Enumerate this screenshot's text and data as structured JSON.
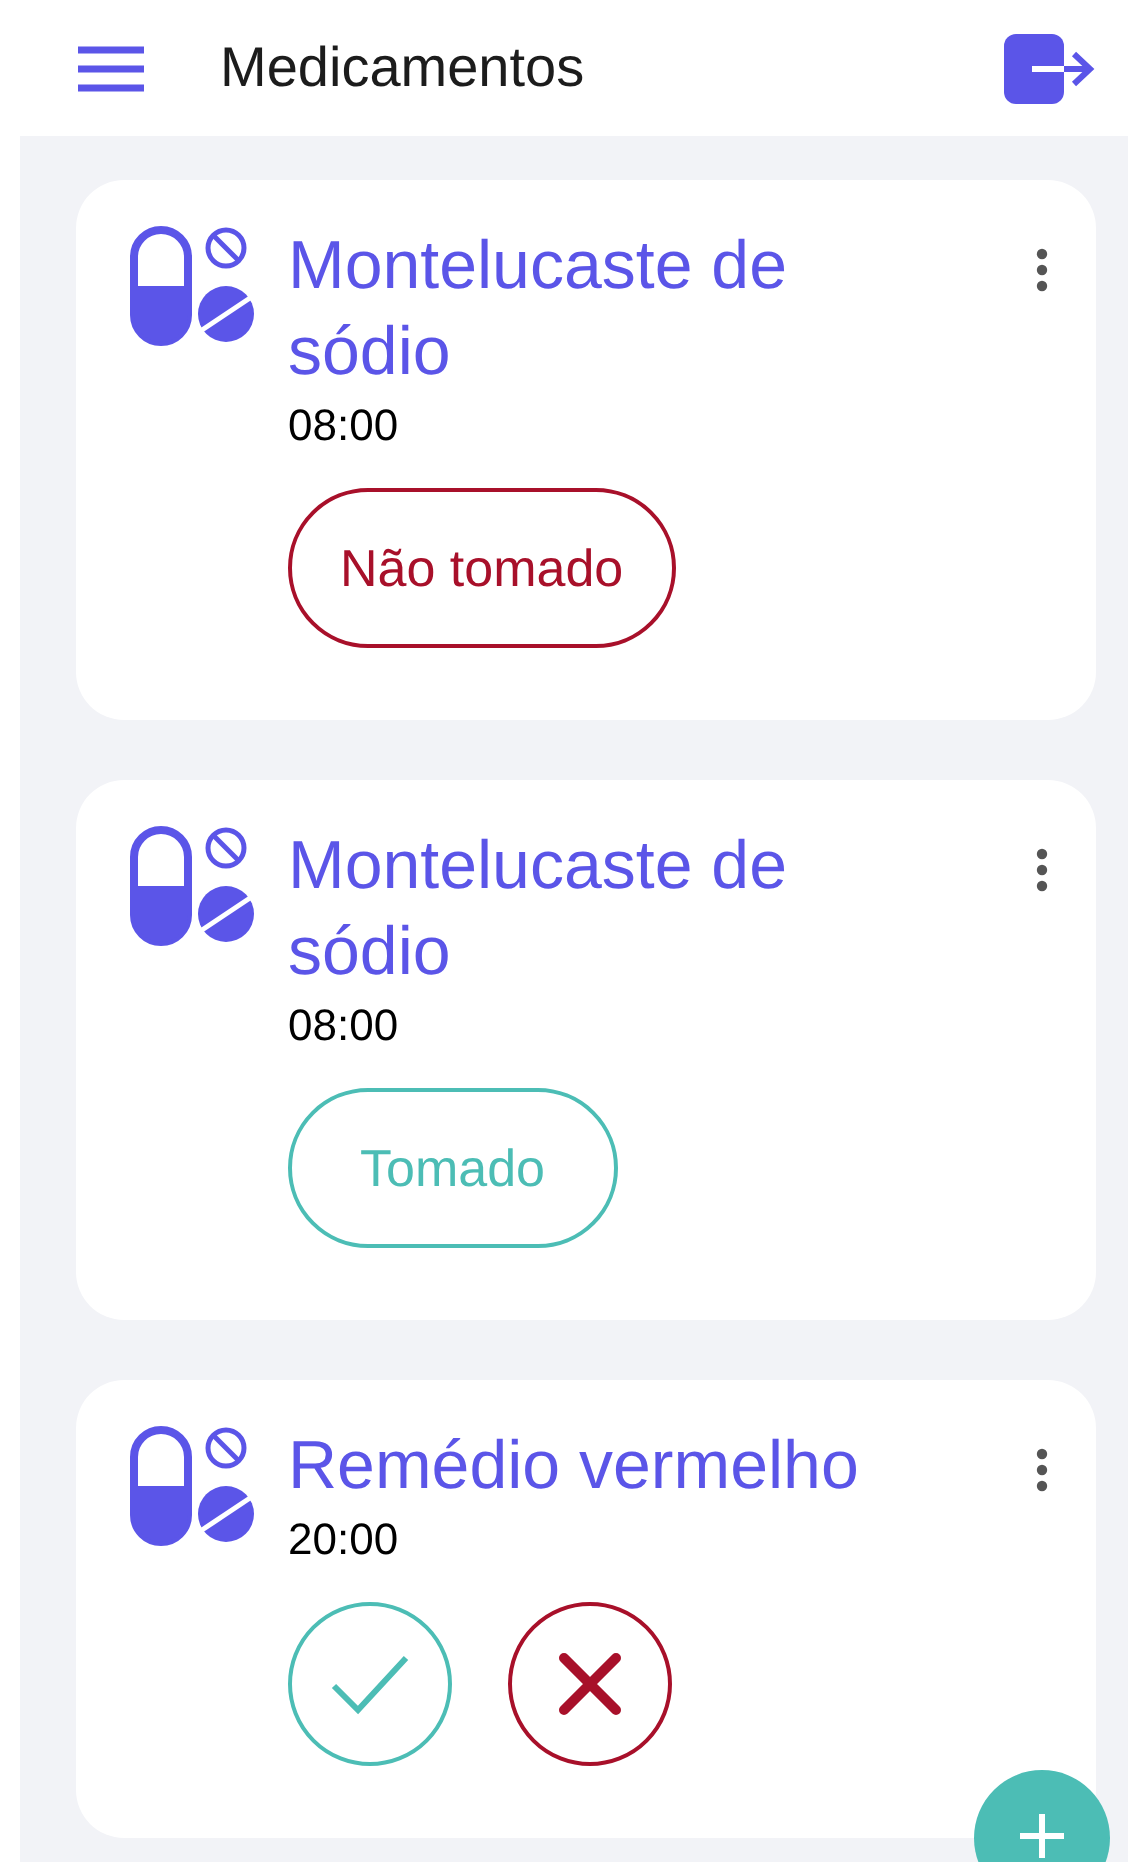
{
  "app_bar": {
    "title": "Medicamentos"
  },
  "medications": [
    {
      "name": "Montelucaste de sódio",
      "time": "08:00",
      "kind": "not_taken",
      "status_label": "Não tomado"
    },
    {
      "name": "Montelucaste de sódio",
      "time": "08:00",
      "kind": "taken",
      "status_label": "Tomado"
    },
    {
      "name": "Remédio vermelho",
      "time": "20:00",
      "kind": "pending"
    }
  ]
}
